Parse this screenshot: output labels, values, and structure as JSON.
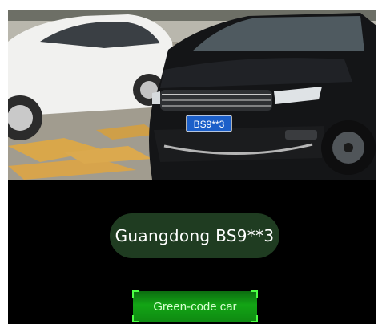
{
  "camera": {
    "plate_on_car": "BS9**3"
  },
  "result": {
    "plate_text": "Guangdong BS9**3"
  },
  "status": {
    "label": "Green-code car",
    "color": "#13a515"
  },
  "colors": {
    "background": "#000000",
    "pill": "#1f3c21",
    "corner_accent": "#4cff44"
  }
}
